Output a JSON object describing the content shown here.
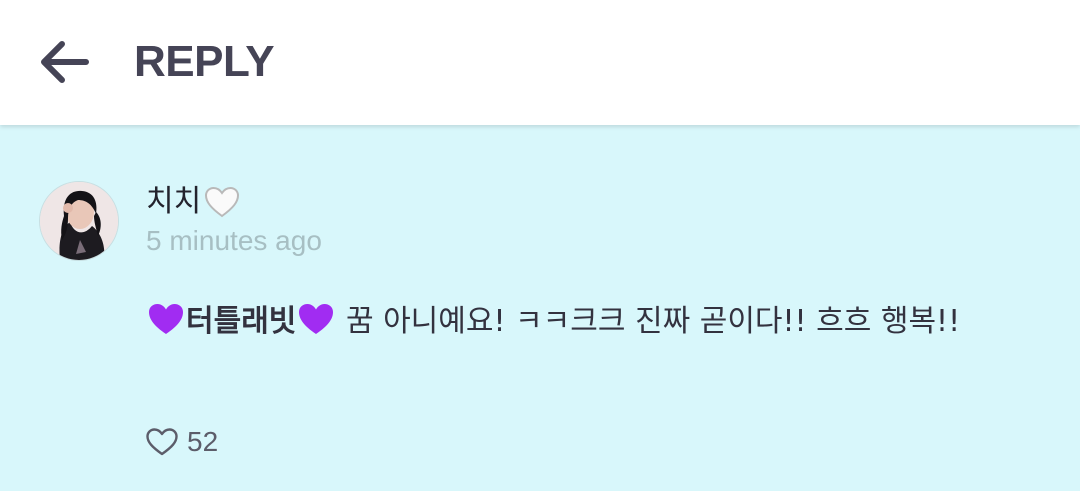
{
  "header": {
    "title": "REPLY",
    "back_icon": "arrow-left-icon"
  },
  "comment": {
    "username": "치치",
    "username_emoji": "white-heart-icon",
    "time_ago": "5 minutes ago",
    "message": {
      "tag": "터틀래빗",
      "tag_emoji": "purple-heart-icon",
      "text": " 꿈 아니예요! ㅋㅋ크크 진짜 곧이다!! 흐흐 행복!!"
    },
    "likes": "52",
    "like_icon": "heart-outline-icon"
  },
  "colors": {
    "header_bg": "#ffffff",
    "content_bg": "#d8f7fb",
    "title": "#454456",
    "timestamp": "#a7bfc3",
    "purple_heart": "#9b2cf0"
  }
}
